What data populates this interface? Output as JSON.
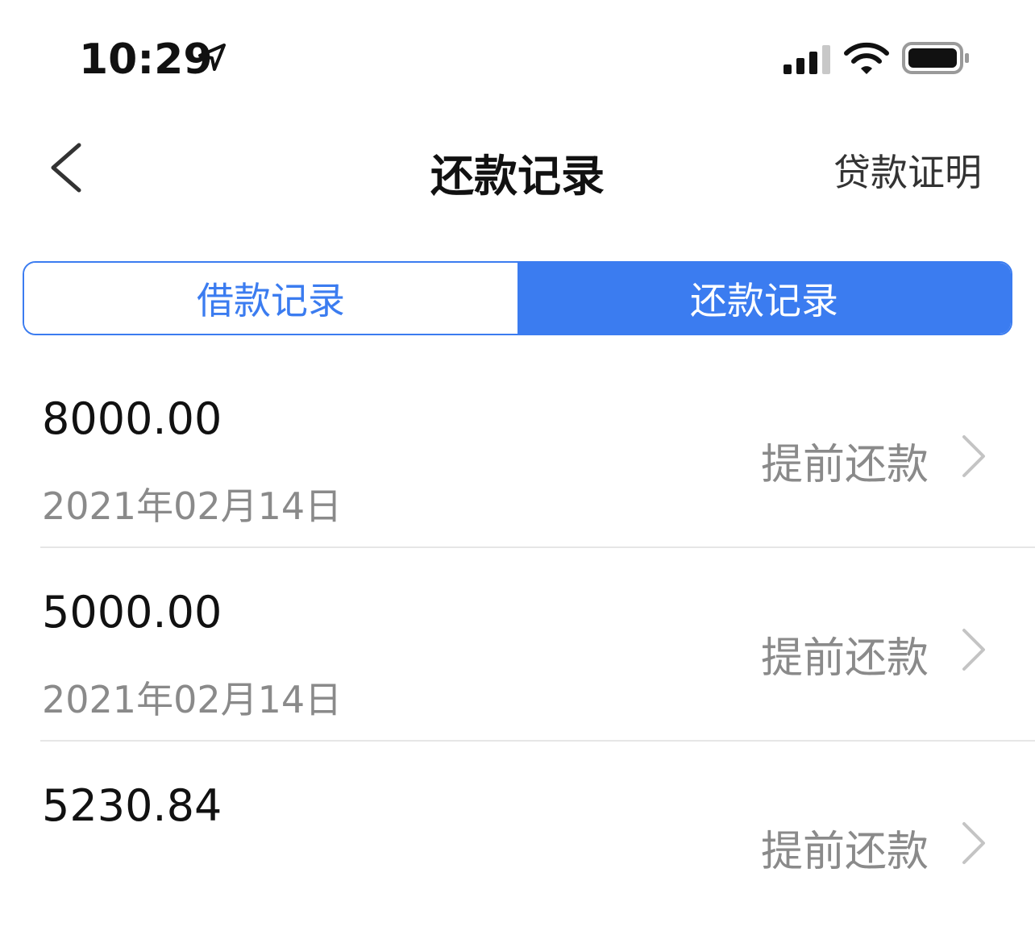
{
  "status_bar": {
    "time": "10:29",
    "icons": [
      "location-arrow-icon",
      "signal-icon",
      "wifi-icon",
      "battery-icon"
    ]
  },
  "nav": {
    "back_icon": "chevron-left-icon",
    "title": "还款记录",
    "right_action": "贷款证明"
  },
  "tabs": [
    {
      "label": "借款记录",
      "active": false
    },
    {
      "label": "还款记录",
      "active": true
    }
  ],
  "records": [
    {
      "amount": "8000.00",
      "date": "2021年02月14日",
      "action": "提前还款"
    },
    {
      "amount": "5000.00",
      "date": "2021年02月14日",
      "action": "提前还款"
    },
    {
      "amount": "5230.84",
      "date": "",
      "action": "提前还款"
    }
  ],
  "colors": {
    "accent": "#3b7cf0",
    "text_primary": "#111111",
    "text_secondary": "#8a8a8a",
    "divider": "#e6e6e6"
  }
}
